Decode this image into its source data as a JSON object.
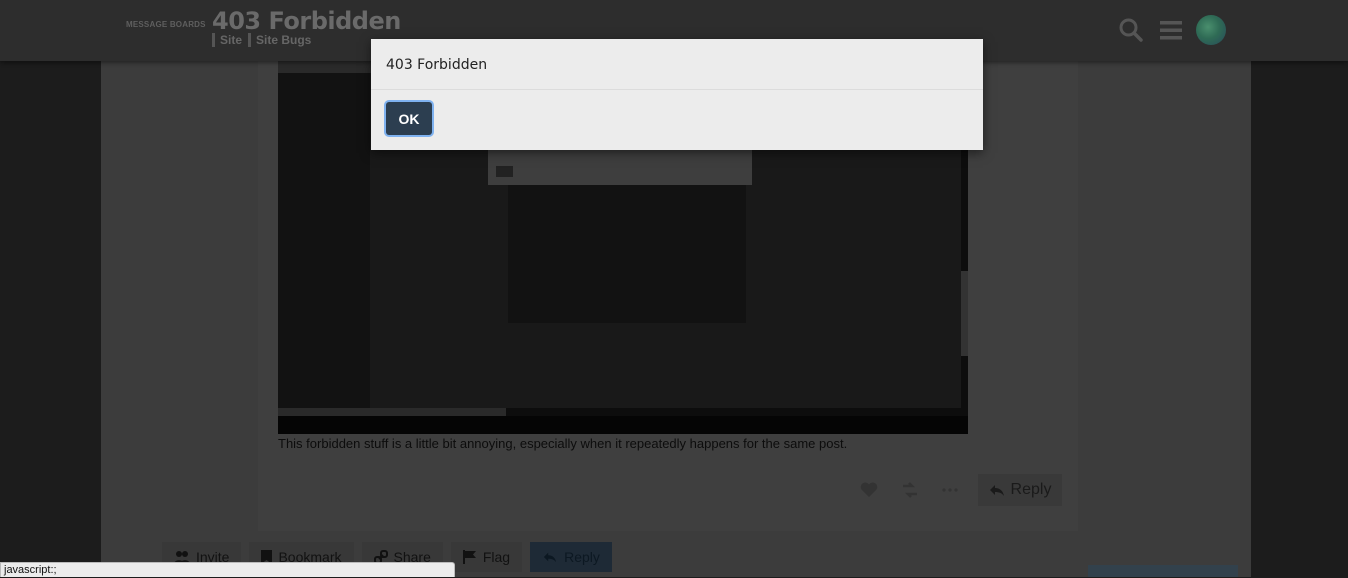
{
  "header": {
    "brand": "MESSAGE BOARDS",
    "topic_title": "403 Forbidden",
    "breadcrumbs": [
      "Site",
      "Site Bugs"
    ]
  },
  "post": {
    "text": "This forbidden stuff is a little bit annoying, especially when it repeatedly happens for the same post.",
    "reply_label": "Reply"
  },
  "footer_buttons": {
    "invite": "Invite",
    "bookmark": "Bookmark",
    "share": "Share",
    "flag": "Flag",
    "reply": "Reply"
  },
  "modal": {
    "message": "403 Forbidden",
    "ok_label": "OK"
  },
  "statusbar": {
    "text": "javascript:;"
  },
  "icons": [
    "search-icon",
    "hamburger-menu-icon",
    "heart-icon",
    "link-icon",
    "ellipsis-icon",
    "reply-icon",
    "invite-icon",
    "bookmark-icon",
    "share-icon",
    "flag-icon"
  ],
  "colors": {
    "modal_button": "#2c3e50",
    "focus_ring": "#7fb2f0",
    "modal_bg": "#ececec"
  }
}
